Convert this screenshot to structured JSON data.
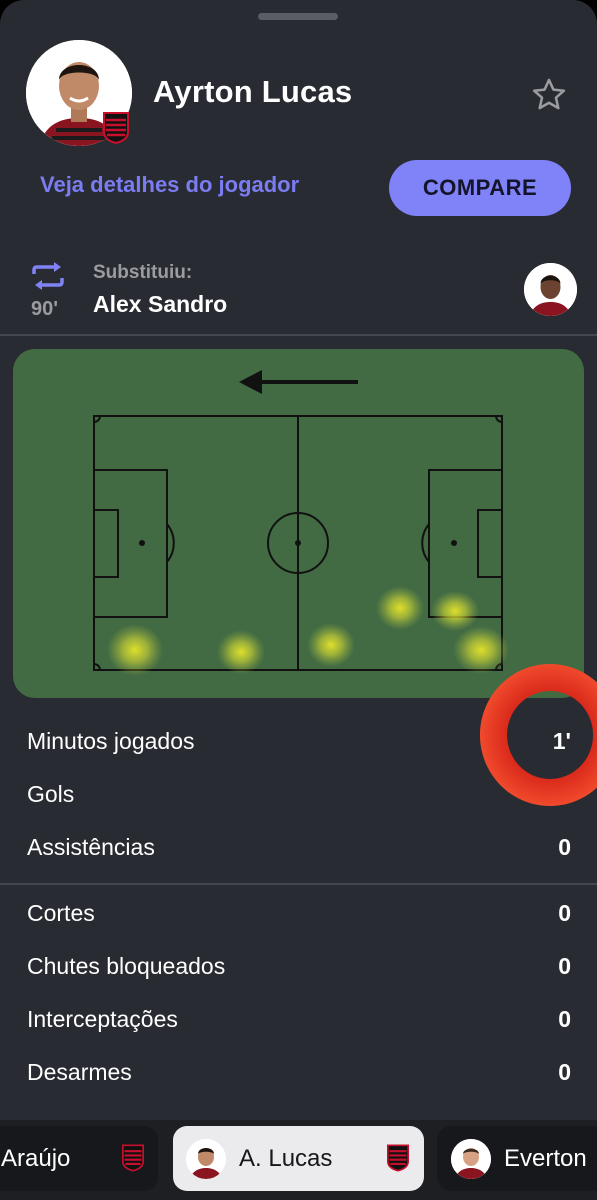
{
  "player": {
    "name": "Ayrton Lucas",
    "details_link": "Veja detalhes do jogador",
    "compare_label": "COMPARE"
  },
  "substitution": {
    "label": "Substituiu:",
    "player": "Alex Sandro",
    "minute": "90'"
  },
  "stats_group_1": [
    {
      "label": "Minutos jogados",
      "value": "1'"
    },
    {
      "label": "Gols",
      "value": ""
    },
    {
      "label": "Assistências",
      "value": "0"
    }
  ],
  "stats_group_2": [
    {
      "label": "Cortes",
      "value": "0"
    },
    {
      "label": "Chutes bloqueados",
      "value": "0"
    },
    {
      "label": "Interceptações",
      "value": "0"
    },
    {
      "label": "Desarmes",
      "value": "0"
    }
  ],
  "carousel": [
    {
      "name": "Araújo"
    },
    {
      "name": "A. Lucas"
    },
    {
      "name": "Everton"
    }
  ],
  "colors": {
    "background": "#282b31",
    "accent": "#8082f8",
    "link": "#7b7cf2",
    "pitch": "#436b43",
    "heat": "#e7e52a",
    "club_red": "#c8102e",
    "indicator": "#e8321e"
  }
}
